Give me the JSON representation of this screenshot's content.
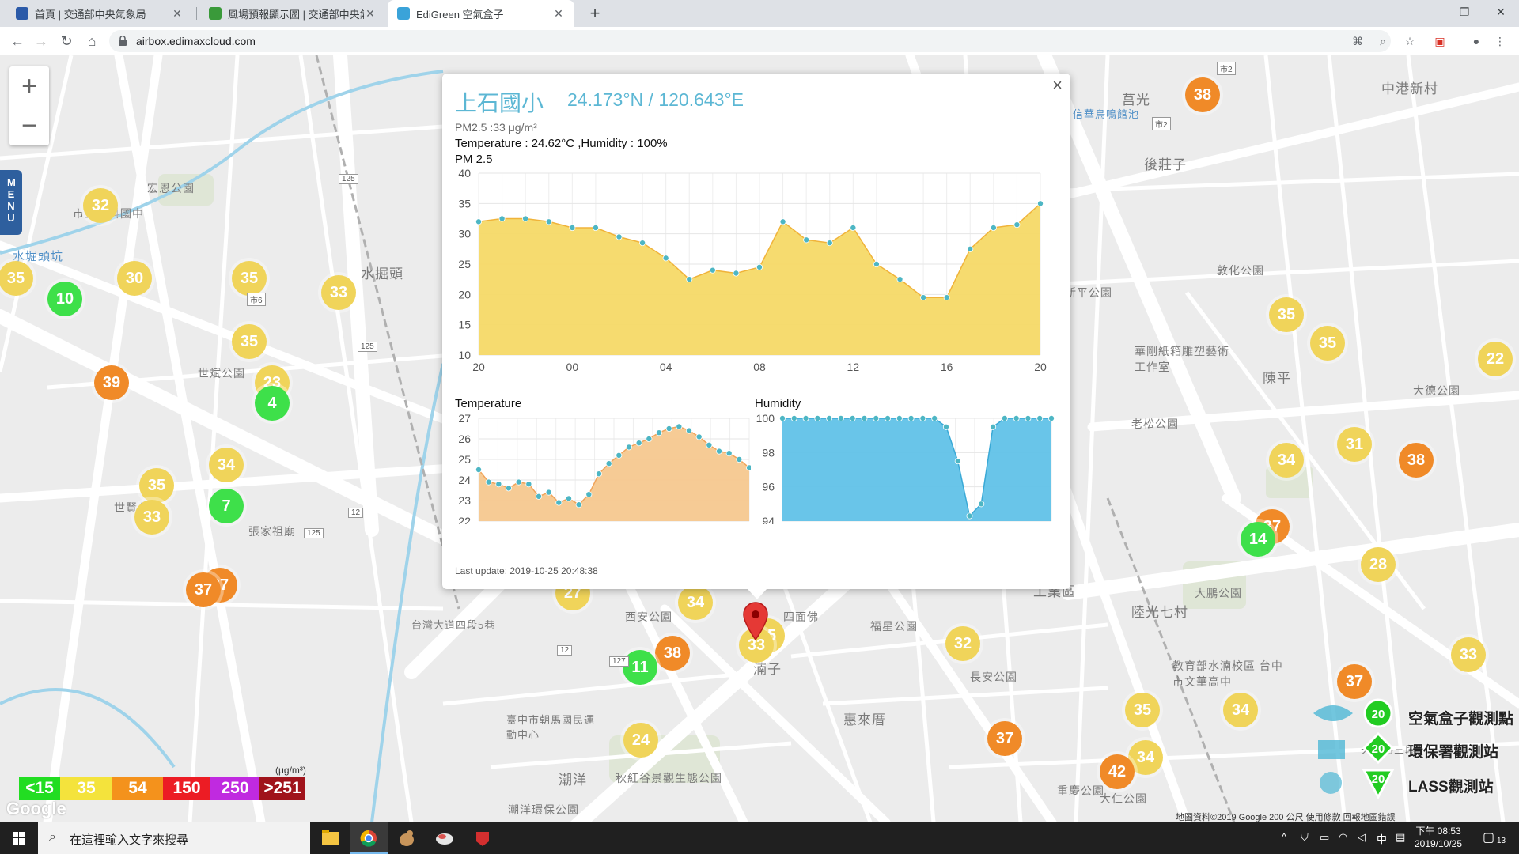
{
  "browser": {
    "tabs": [
      {
        "title": "首頁 | 交通部中央氣象局",
        "active": false
      },
      {
        "title": "風場預報顯示圖 | 交通部中央氣象局",
        "active": false
      },
      {
        "title": "EdiGreen 空氣盒子",
        "active": true
      }
    ],
    "url": "airbox.edimaxcloud.com"
  },
  "map": {
    "place_labels": [
      {
        "text": "水掘頭",
        "kind": "town"
      },
      {
        "text": "水堀頭坑",
        "kind": "water"
      },
      {
        "text": "宏恩公園",
        "kind": "park"
      },
      {
        "text": "市立福科國中",
        "kind": "school"
      },
      {
        "text": "世賢公園",
        "kind": "park"
      },
      {
        "text": "張家祖廟",
        "kind": "poi"
      },
      {
        "text": "世斌公園",
        "kind": "park"
      },
      {
        "text": "後莊子",
        "kind": "town"
      },
      {
        "text": "敦化公園",
        "kind": "park"
      },
      {
        "text": "新平公園",
        "kind": "park"
      },
      {
        "text": "陳平",
        "kind": "town"
      },
      {
        "text": "大德公園",
        "kind": "park"
      },
      {
        "text": "老松公園",
        "kind": "park"
      },
      {
        "text": "工業區",
        "kind": "district"
      },
      {
        "text": "陸光七村",
        "kind": "district"
      },
      {
        "text": "大鵬公園",
        "kind": "park"
      },
      {
        "text": "福星公園",
        "kind": "park"
      },
      {
        "text": "西安公園",
        "kind": "park"
      },
      {
        "text": "四面佛",
        "kind": "poi"
      },
      {
        "text": "湳子",
        "kind": "town"
      },
      {
        "text": "惠來厝",
        "kind": "town"
      },
      {
        "text": "長安公園",
        "kind": "park"
      },
      {
        "text": "潮洋",
        "kind": "town"
      },
      {
        "text": "秋紅谷景觀生態公園",
        "kind": "park"
      },
      {
        "text": "臺中市朝馬國民運動中心",
        "kind": "poi"
      },
      {
        "text": "教育部水湳校區 台中市文華高中",
        "kind": "school"
      },
      {
        "text": "華剛紙箱雕塑藝術工作室",
        "kind": "poi"
      },
      {
        "text": "中港新村",
        "kind": "town"
      },
      {
        "text": "莒光",
        "kind": "town"
      },
      {
        "text": "信華鳥鳴館池",
        "kind": "water"
      },
      {
        "text": "重慶公園",
        "kind": "park"
      },
      {
        "text": "大仁公園",
        "kind": "park"
      },
      {
        "text": "潮洋環保公園",
        "kind": "park"
      },
      {
        "text": "台灣大道四段5巷",
        "kind": "road"
      },
      {
        "text": "天津路三段",
        "kind": "road"
      }
    ],
    "markers": [
      {
        "value": "32",
        "level": "yellow"
      },
      {
        "value": "35",
        "level": "yellow"
      },
      {
        "value": "10",
        "level": "green"
      },
      {
        "value": "30",
        "level": "yellow"
      },
      {
        "value": "35",
        "level": "yellow"
      },
      {
        "value": "33",
        "level": "yellow"
      },
      {
        "value": "35",
        "level": "yellow"
      },
      {
        "value": "39",
        "level": "orange"
      },
      {
        "value": "23",
        "level": "yellow"
      },
      {
        "value": "4",
        "level": "green"
      },
      {
        "value": "34",
        "level": "yellow"
      },
      {
        "value": "35",
        "level": "yellow"
      },
      {
        "value": "7",
        "level": "green"
      },
      {
        "value": "33",
        "level": "yellow"
      },
      {
        "value": "37",
        "level": "orange"
      },
      {
        "value": "37",
        "level": "orange"
      },
      {
        "value": "27",
        "level": "yellow"
      },
      {
        "value": "34",
        "level": "yellow"
      },
      {
        "value": "38",
        "level": "orange"
      },
      {
        "value": "11",
        "level": "green"
      },
      {
        "value": "35",
        "level": "yellow"
      },
      {
        "value": "33",
        "level": "yellow"
      },
      {
        "value": "24",
        "level": "yellow"
      },
      {
        "value": "32",
        "level": "yellow"
      },
      {
        "value": "37",
        "level": "orange"
      },
      {
        "value": "38",
        "level": "orange"
      },
      {
        "value": "35",
        "level": "yellow"
      },
      {
        "value": "35",
        "level": "yellow"
      },
      {
        "value": "22",
        "level": "yellow"
      },
      {
        "value": "34",
        "level": "yellow"
      },
      {
        "value": "31",
        "level": "yellow"
      },
      {
        "value": "38",
        "level": "orange"
      },
      {
        "value": "37",
        "level": "orange"
      },
      {
        "value": "14",
        "level": "green"
      },
      {
        "value": "28",
        "level": "yellow"
      },
      {
        "value": "33",
        "level": "yellow"
      },
      {
        "value": "37",
        "level": "orange"
      },
      {
        "value": "35",
        "level": "yellow"
      },
      {
        "value": "34",
        "level": "yellow"
      },
      {
        "value": "34",
        "level": "yellow"
      },
      {
        "value": "42",
        "level": "orange"
      }
    ],
    "road_badges": [
      "125",
      "125",
      "125",
      "12",
      "12",
      "市6",
      "市2",
      "市2",
      "127"
    ],
    "zoom_in": "+",
    "zoom_out": "−",
    "menu_label": "MENU",
    "scale_unit": "(μg/m³)",
    "scale": [
      {
        "label": "<15",
        "color": "#22dd22"
      },
      {
        "label": "35",
        "color": "#f4e33c"
      },
      {
        "label": "54",
        "color": "#f4921c"
      },
      {
        "label": "150",
        "color": "#ec1c24"
      },
      {
        "label": "250",
        "color": "#c02ae0"
      },
      {
        "label": ">251",
        "color": "#a0131b"
      }
    ],
    "google_logo": "Google",
    "attribution": "地圖資料©2019 Google   200 公尺   使用條款   回報地圖錯誤",
    "legend": [
      {
        "label": "空氣盒子觀測點",
        "value": "20",
        "icon": "circle"
      },
      {
        "label": "環保署觀測站",
        "value": "20",
        "icon": "diamond"
      },
      {
        "label": "LASS觀測站",
        "value": "20",
        "icon": "triangle"
      }
    ]
  },
  "popup": {
    "station": "上石國小",
    "coord": "24.173°N / 120.643°E",
    "pm_line": "PM2.5 :33 μg/m³",
    "temp_line": "Temperature : 24.62°C ,Humidity : 100%",
    "pm_title": "PM 2.5",
    "temp_title": "Temperature",
    "hum_title": "Humidity",
    "last_update": "Last update: 2019-10-25 20:48:38",
    "close_label": "×"
  },
  "chart_data": [
    {
      "type": "area",
      "title": "PM 2.5",
      "x_ticks": [
        "20",
        "00",
        "04",
        "08",
        "12",
        "16",
        "20"
      ],
      "y_ticks": [
        10,
        15,
        20,
        25,
        30,
        35,
        40
      ],
      "ylim": [
        10,
        40
      ],
      "color": "#f5d967",
      "series": [
        {
          "values": [
            32,
            32.5,
            32.5,
            32,
            31,
            31,
            29.5,
            28.5,
            26,
            22.5,
            24,
            23.5,
            24.5,
            32,
            29,
            28.5,
            31,
            25,
            22.5,
            19.5,
            19.5,
            27.5,
            31,
            31.5,
            35
          ]
        }
      ]
    },
    {
      "type": "area",
      "title": "Temperature",
      "y_ticks": [
        22,
        23,
        24,
        25,
        26,
        27
      ],
      "ylim": [
        22,
        27
      ],
      "color": "#f5c88f",
      "series": [
        {
          "values": [
            24.5,
            23.9,
            23.8,
            23.6,
            23.9,
            23.8,
            23.2,
            23.4,
            22.9,
            23.1,
            22.8,
            23.3,
            24.3,
            24.8,
            25.2,
            25.6,
            25.8,
            26.0,
            26.3,
            26.5,
            26.6,
            26.4,
            26.1,
            25.7,
            25.4,
            25.3,
            25.0,
            24.6
          ]
        }
      ]
    },
    {
      "type": "area",
      "title": "Humidity",
      "y_ticks": [
        94,
        96,
        98,
        100
      ],
      "ylim": [
        94,
        100
      ],
      "color": "#61c2e8",
      "series": [
        {
          "values": [
            100,
            100,
            100,
            100,
            100,
            100,
            100,
            100,
            100,
            100,
            100,
            100,
            100,
            100,
            99.5,
            97.5,
            94.3,
            95,
            99.5,
            100,
            100,
            100,
            100,
            100
          ]
        }
      ]
    }
  ],
  "taskbar": {
    "search_placeholder": "在這裡輸入文字來搜尋",
    "time": "下午 08:53",
    "date": "2019/10/25",
    "ime": "中",
    "notifications": "13"
  }
}
